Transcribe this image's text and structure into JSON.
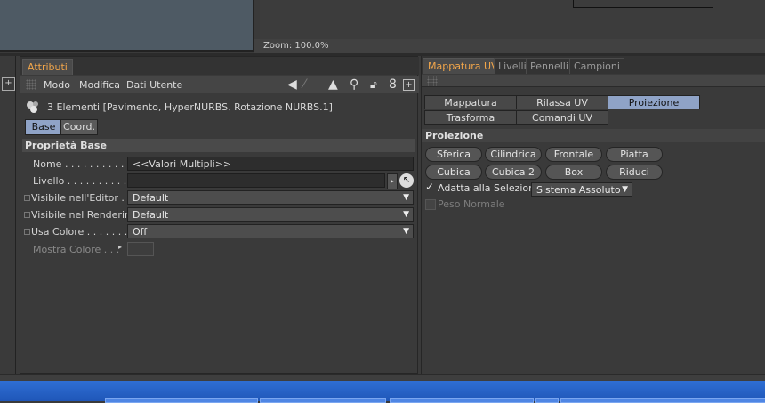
{
  "viewport": {
    "zoom_label": "Zoom: 100.0%"
  },
  "attributes": {
    "tab": "Attributi",
    "menu": [
      "Modo",
      "Modifica",
      "Dati Utente"
    ],
    "object_info": "3 Elementi [Pavimento, HyperNURBS, Rotazione NURBS.1]",
    "subtabs": [
      "Base",
      "Coord."
    ],
    "section_title": "Proprietà Base",
    "properties": [
      {
        "label": "Nome . . . . . . . . . . . . .",
        "value": "<<Valori Multipli>>"
      },
      {
        "label": "Livello . . . . . . . . . . . .",
        "value": ""
      },
      {
        "label": "Visibile nell'Editor . . .",
        "value": "Default"
      },
      {
        "label": "Visibile nel Rendering",
        "value": "Default"
      },
      {
        "label": "Usa Colore . . . . . . . . .",
        "value": "Off"
      },
      {
        "label": "Mostra Colore . . .",
        "value": ""
      }
    ],
    "icons": [
      "arrow-left-icon",
      "arrow-up-icon",
      "search-icon",
      "lock-icon",
      "link-icon",
      "new-panel-icon"
    ]
  },
  "uv": {
    "tabs": [
      "Mappatura UV",
      "Livelli",
      "Pennelli",
      "Campioni"
    ],
    "modes": [
      "Mappatura Ottimale",
      "Rilassa UV",
      "Proiezione",
      "Trasforma",
      "Comandi UV"
    ],
    "active_mode": "Proiezione",
    "section_title": "Proiezione",
    "projection_buttons": [
      "Sferica",
      "Cilindrica",
      "Frontale",
      "Piatta",
      "Cubica",
      "Cubica 2",
      "Box",
      "Riduci"
    ],
    "adapt_label": "Adatta alla Selezione",
    "adapt_checked": true,
    "system_select": "Sistema Assoluto",
    "weight_label": "Peso Normale"
  },
  "colors": {
    "accent_tab": "#f2a64a",
    "active_button": "#8fa3c7",
    "taskbar": "#2f6fd4"
  }
}
